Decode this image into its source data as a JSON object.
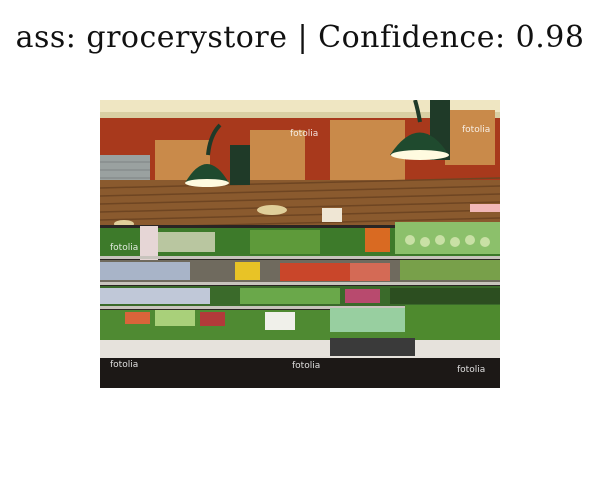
{
  "header": {
    "title": "ass: grocerystore | Confidence: 0.98"
  },
  "image": {
    "watermark": "fotolia",
    "colors": {
      "wall": "#b3421f",
      "panel": "#c98a4a",
      "lamp": "#1f4a2e",
      "shelf": "#2a2523"
    }
  }
}
